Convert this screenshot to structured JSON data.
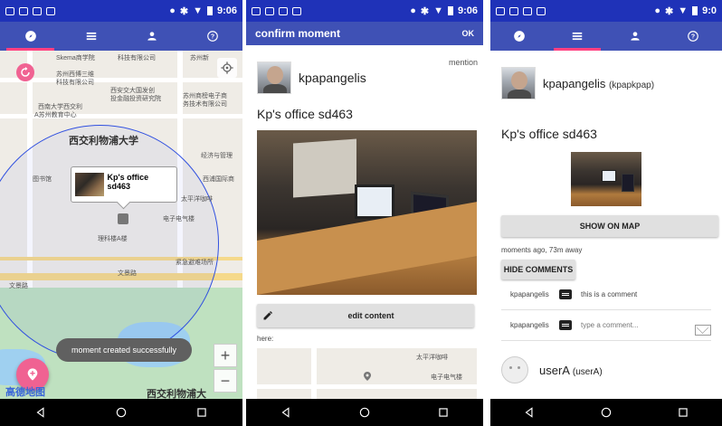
{
  "status": {
    "time": "9:06",
    "time_cropped": "9:0"
  },
  "tabs": [
    "explore-icon",
    "list-icon",
    "person-icon",
    "help-icon"
  ],
  "map": {
    "labels": {
      "l1": "Skema商学院",
      "l2": "科技有限公司",
      "l3": "苏州新",
      "l4": "苏州西博三维",
      "l5": "科技有限公司",
      "l6": "西安交大国发创",
      "l7": "投金融投资研究院",
      "l8": "苏州商榜电子商",
      "l9": "务技术有限公司",
      "l10": "西南大学西交利",
      "l11": "A苏州教育中心",
      "l12": "西交利物浦大学",
      "l13": "经济与管理",
      "l14": "图书馆",
      "l15": "西浦国际商",
      "l16": "太平洋咖啡",
      "l17": "电子电气楼",
      "l18": "理科楼A楼",
      "l19": "紧急避难场所",
      "l20": "文景路",
      "l21": "文景路",
      "l22": "西交利物浦大",
      "logo": "高德地图"
    },
    "bubble_title": "Kp's office sd463",
    "toast": "moment created successfully",
    "zoom_in": "+",
    "zoom_out": "−"
  },
  "confirm": {
    "title": "confirm moment",
    "ok": "OK",
    "username": "kpapangelis",
    "mention": "mention",
    "moment_title": "Kp's office sd463",
    "edit_label": "edit content",
    "here_label": "here:",
    "minimap_l1": "太平洋咖啡",
    "minimap_l2": "电子电气楼"
  },
  "detail": {
    "username": "kpapangelis",
    "handle": "(kpapkpap)",
    "moment_title": "Kp's office sd463",
    "show_map": "SHOW ON MAP",
    "meta": "moments ago, 73m away",
    "hide_comments": "HIDE COMMENTS",
    "comments": [
      {
        "user": "kpapangelis",
        "text": "this is a comment"
      }
    ],
    "compose_user": "kpapangelis",
    "compose_placeholder": "type a comment...",
    "followers": [
      {
        "name": "userA",
        "handle": "(userA)"
      }
    ]
  },
  "colors": {
    "status": "#1f32b8",
    "primary": "#3f51b5",
    "accent": "#ff4081",
    "fab": "#f06292"
  }
}
